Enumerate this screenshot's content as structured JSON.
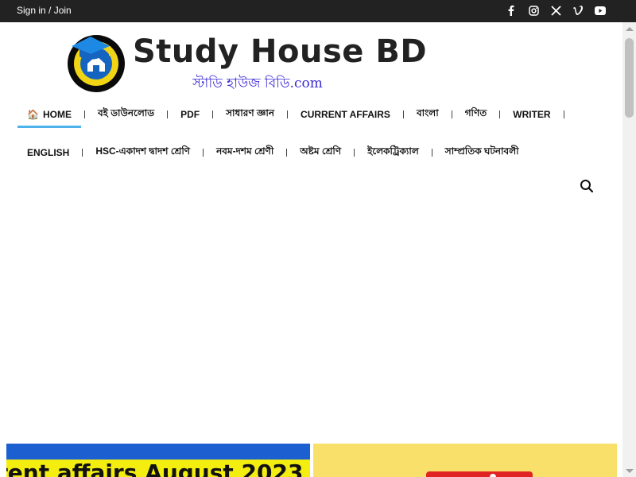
{
  "topbar": {
    "signin_label": "Sign in / Join",
    "social_icons": [
      "facebook-icon",
      "instagram-icon",
      "x-icon",
      "vimeo-icon",
      "youtube-icon"
    ]
  },
  "header": {
    "title": "Study House BD",
    "subtitle": "স্টাডি হাউজ বিডি.com",
    "logo_text": "STUDY HOUSE BD"
  },
  "nav": {
    "row1": [
      {
        "label": "HOME",
        "active": true
      },
      {
        "label": "বই ডাউনলোড"
      },
      {
        "label": "PDF"
      },
      {
        "label": "সাধারণ জ্ঞান"
      },
      {
        "label": "CURRENT AFFAIRS"
      },
      {
        "label": "বাংলা"
      },
      {
        "label": "গণিত"
      },
      {
        "label": "WRITER"
      }
    ],
    "row2": [
      {
        "label": "ENGLISH"
      },
      {
        "label": "HSC-একাদশ দ্বাদশ শ্রেণি"
      },
      {
        "label": "নবম-দশম শ্রেণী"
      },
      {
        "label": "অষ্টম শ্রেণি"
      },
      {
        "label": "ইলেকট্রিক্যাল"
      },
      {
        "label": "সাম্প্রতিক ঘটনাবলী"
      }
    ]
  },
  "cards": {
    "card1_text": "rent affairs August 2023"
  },
  "colors": {
    "topbar_bg": "#222222",
    "accent": "#4db2ec",
    "subtitle": "#3b2bd6"
  }
}
